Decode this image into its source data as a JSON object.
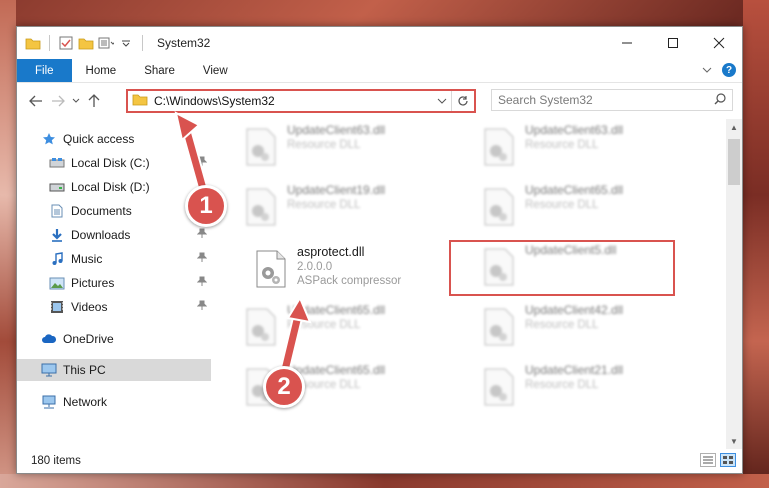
{
  "window": {
    "title": "System32"
  },
  "ribbon": {
    "tabs": [
      "File",
      "Home",
      "Share",
      "View"
    ],
    "help": "?"
  },
  "navigation": {
    "address": "C:\\Windows\\System32",
    "search_placeholder": "Search System32"
  },
  "sidebar": {
    "items": [
      {
        "label": "Quick access",
        "icon": "star-icon",
        "pinned": false
      },
      {
        "label": "Local Disk (C:)",
        "icon": "drive-icon",
        "pinned": true
      },
      {
        "label": "Local Disk (D:)",
        "icon": "drive-icon",
        "pinned": false
      },
      {
        "label": "Documents",
        "icon": "document-icon",
        "pinned": true
      },
      {
        "label": "Downloads",
        "icon": "download-icon",
        "pinned": true
      },
      {
        "label": "Music",
        "icon": "music-icon",
        "pinned": true
      },
      {
        "label": "Pictures",
        "icon": "pictures-icon",
        "pinned": true
      },
      {
        "label": "Videos",
        "icon": "video-icon",
        "pinned": true
      },
      {
        "label": "OneDrive",
        "icon": "cloud-icon",
        "pinned": false
      },
      {
        "label": "This PC",
        "icon": "pc-icon",
        "pinned": false
      },
      {
        "label": "Network",
        "icon": "network-icon",
        "pinned": false
      }
    ]
  },
  "files": [
    {
      "name": "UpdateClient63.dll",
      "type": "Resource DLL",
      "blurred": true
    },
    {
      "name": "UpdateClient63.dll",
      "type": "Resource DLL",
      "blurred": true
    },
    {
      "name": "UpdateClient19.dll",
      "type": "Resource DLL",
      "blurred": true
    },
    {
      "name": "UpdateClient65.dll",
      "type": "Resource DLL",
      "blurred": true
    },
    {
      "name": "asprotect.dll",
      "version": "2.0.0.0",
      "type": "ASPack compressor",
      "blurred": false
    },
    {
      "name": "UpdateClient5.dll",
      "type": "Resource DLL",
      "blurred": true
    },
    {
      "name": "UpdateClient65.dll",
      "type": "Resource DLL",
      "blurred": true
    },
    {
      "name": "UpdateClient42.dll",
      "type": "Resource DLL",
      "blurred": true
    },
    {
      "name": "UpdateClient65.dll",
      "type": "Resource DLL",
      "blurred": true
    },
    {
      "name": "UpdateClient21.dll",
      "type": "Resource DLL",
      "blurred": true
    }
  ],
  "status": {
    "item_count": "180 items"
  },
  "annotations": {
    "step1": "1",
    "step2": "2"
  },
  "colors": {
    "accent": "#1979ca",
    "highlight": "#d9534f"
  }
}
